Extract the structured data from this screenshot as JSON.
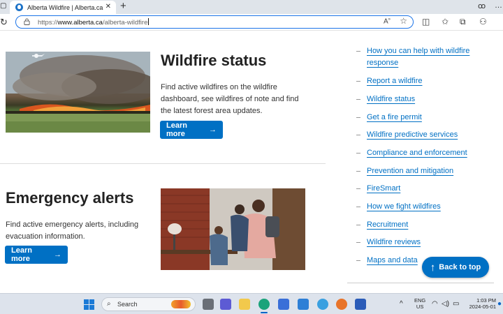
{
  "browser": {
    "tab_title": "Alberta Wildfire | Alberta.ca",
    "tab_close": "✕",
    "new_tab": "+",
    "url_prefix": "https://",
    "url_domain": "www.alberta.ca",
    "url_path": "/alberta-wildfire"
  },
  "sections": {
    "wildfire_status": {
      "title": "Wildfire status",
      "description": "Find active wildfires on the wildfire dashboard, see wildfires of note and find the latest forest area updates.",
      "button": "Learn more"
    },
    "emergency_alerts": {
      "title": "Emergency alerts",
      "description": "Find active emergency alerts, including evacuation information.",
      "button": "Learn more"
    }
  },
  "sidebar": {
    "items": [
      "How you can help with wildfire response",
      "Report a wildfire",
      "Wildfire status",
      "Get a fire permit",
      "Wildfire predictive services",
      "Compliance and enforcement",
      "Prevention and mitigation",
      "FireSmart",
      "How we fight wildfires",
      "Recruitment",
      "Wildfire reviews",
      "Maps and data"
    ]
  },
  "back_to_top": "Back to top",
  "taskbar": {
    "search_label": "Search",
    "lang_1": "ENG",
    "lang_2": "US",
    "time": "1:03 PM",
    "date": "2024-05-01"
  },
  "colors": {
    "accent": "#0070c4",
    "link": "#0070c4",
    "heading": "#222222"
  }
}
